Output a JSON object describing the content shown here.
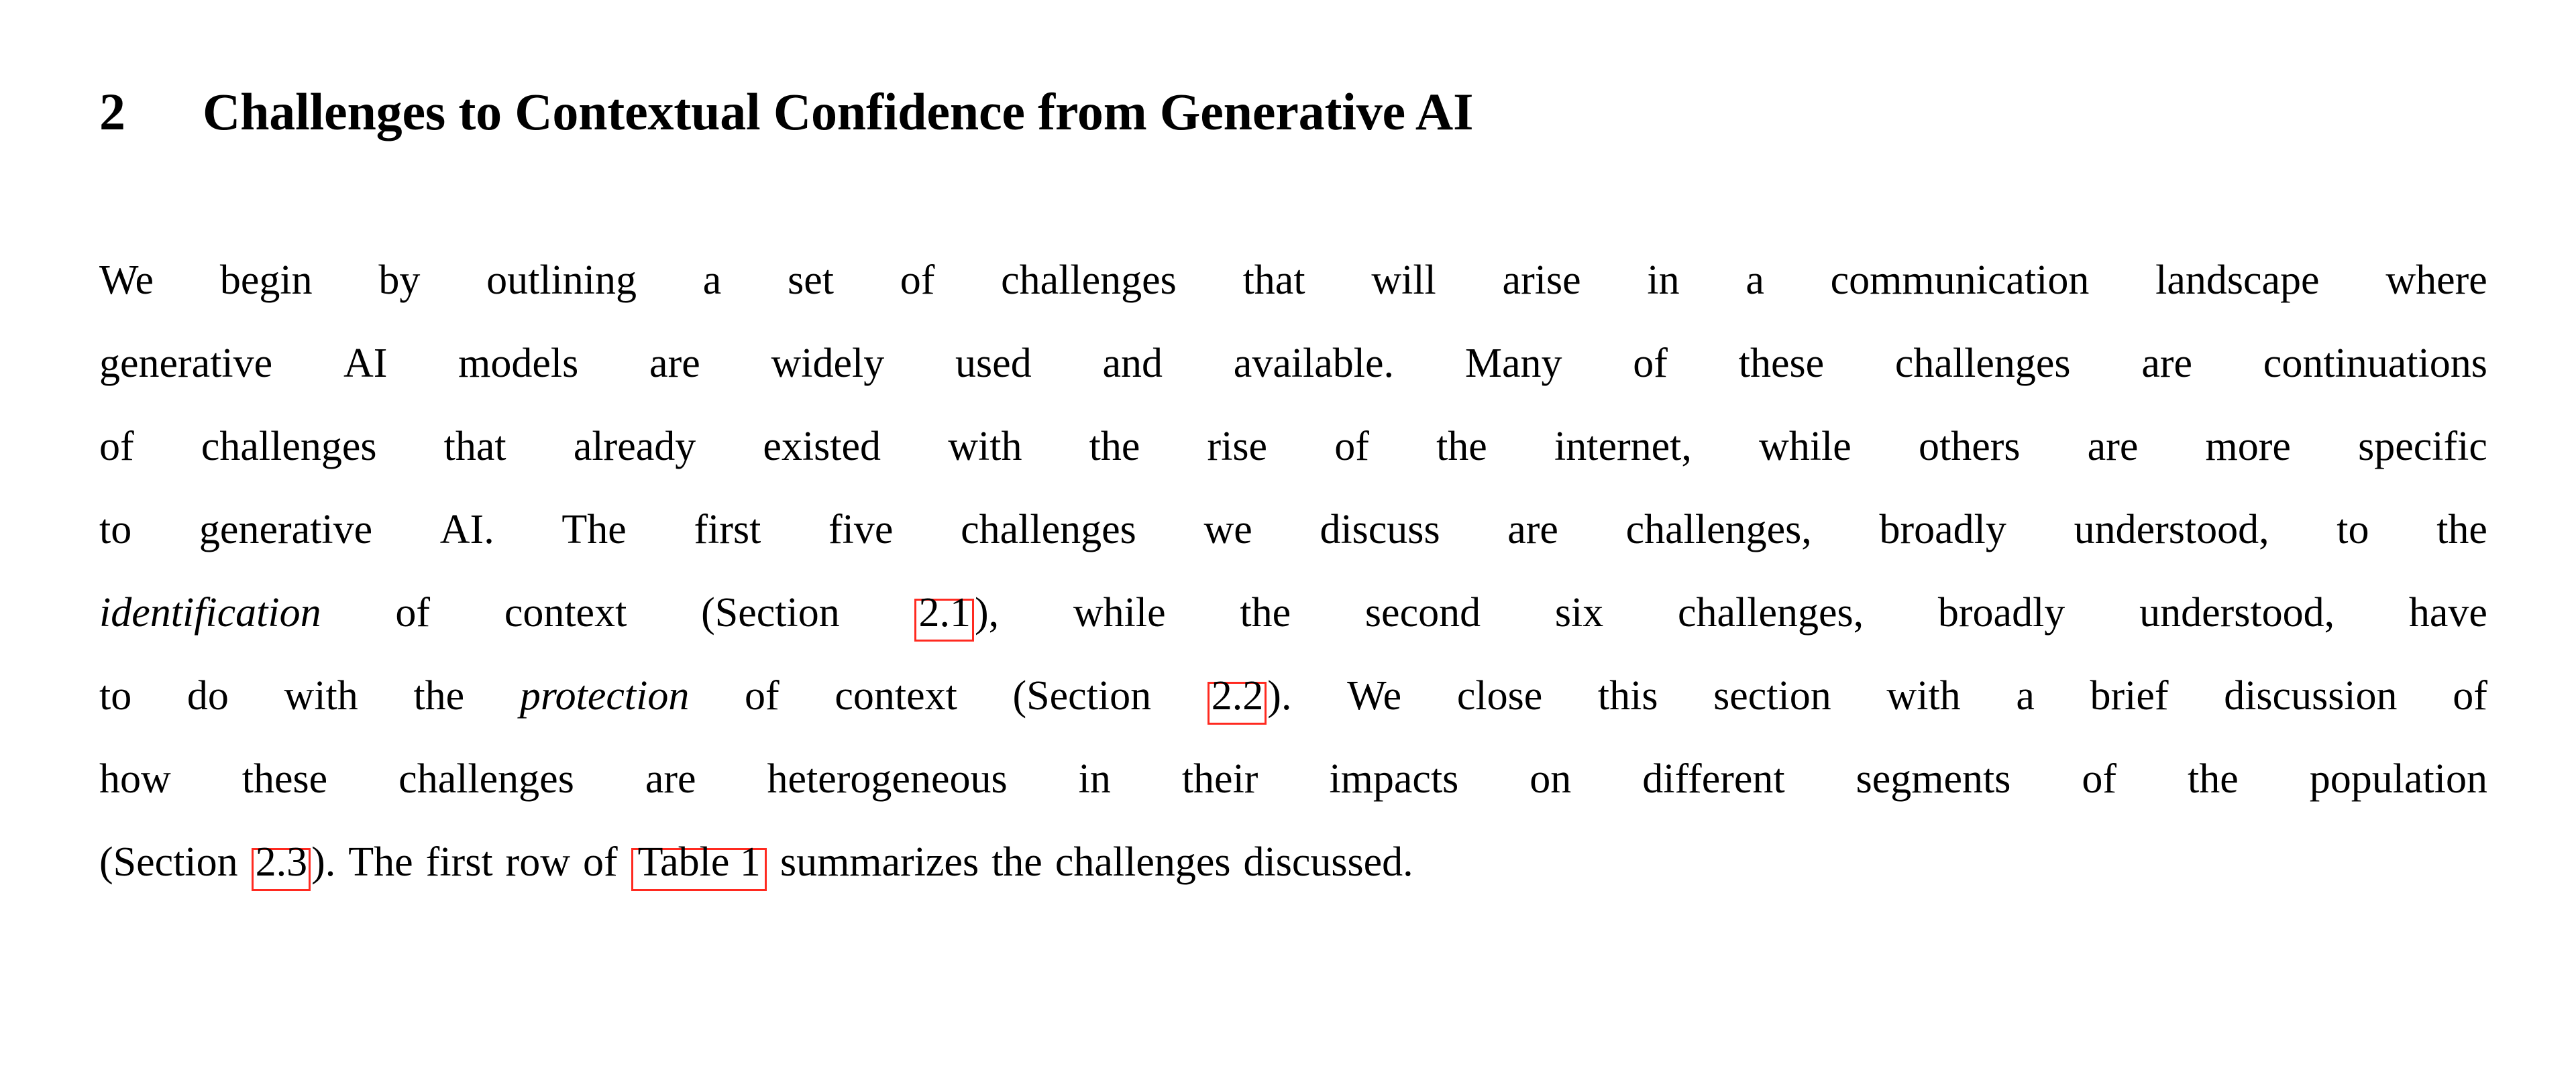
{
  "document": {
    "kind": "academic-paper-section",
    "background_color": "#ffffff",
    "text_color": "#000000",
    "link_box_color": "#ff2a20"
  },
  "heading": {
    "number": "2",
    "title": "Challenges to Contextual Confidence from Generative AI"
  },
  "paragraph": {
    "full_text": "We begin by outlining a set of challenges that will arise in a communication landscape where generative AI models are widely used and available. Many of these challenges are continuations of challenges that already existed with the rise of the internet, while others are more specific to generative AI. The first five challenges we discuss are challenges, broadly understood, to the identification of context (Section 2.1), while the second six challenges, broadly understood, have to do with the protection of context (Section 2.2). We close this section with a brief discussion of how these challenges are heterogeneous in their impacts on different segments of the population (Section 2.3). The first row of Table 1 summarizes the challenges discussed.",
    "lines": [
      {
        "id": "line-1",
        "words": [
          "We",
          "begin",
          "by",
          "outlining",
          "a",
          "set",
          "of",
          "challenges",
          "that",
          "will",
          "arise",
          "in",
          "a",
          "communication",
          "landscape",
          "where"
        ]
      },
      {
        "id": "line-2",
        "words": [
          "generative",
          "AI",
          "models",
          "are",
          "widely",
          "used",
          "and",
          "available.",
          "Many",
          "of",
          "these",
          "challenges",
          "are",
          "continuations"
        ]
      },
      {
        "id": "line-3",
        "words": [
          "of",
          "challenges",
          "that",
          "already",
          "existed",
          "with",
          "the",
          "rise",
          "of",
          "the",
          "internet,",
          "while",
          "others",
          "are",
          "more",
          "specific"
        ]
      },
      {
        "id": "line-4",
        "words": [
          "to",
          "generative",
          "AI.",
          "The",
          "first",
          "five",
          "challenges",
          "we",
          "discuss",
          "are",
          "challenges,",
          "broadly",
          "understood,",
          "to",
          "the"
        ]
      },
      {
        "id": "line-5",
        "segments": [
          {
            "type": "italic",
            "text": "identification"
          },
          {
            "type": "text",
            "text": "of"
          },
          {
            "type": "text",
            "text": "context"
          },
          {
            "type": "text",
            "text": "(Section"
          },
          {
            "type": "link",
            "text": "2.1",
            "trailing": "),"
          },
          {
            "type": "text",
            "text": "while"
          },
          {
            "type": "text",
            "text": "the"
          },
          {
            "type": "text",
            "text": "second"
          },
          {
            "type": "text",
            "text": "six"
          },
          {
            "type": "text",
            "text": "challenges,"
          },
          {
            "type": "text",
            "text": "broadly"
          },
          {
            "type": "text",
            "text": "understood,"
          },
          {
            "type": "text",
            "text": "have"
          }
        ]
      },
      {
        "id": "line-6",
        "segments": [
          {
            "type": "text",
            "text": "to"
          },
          {
            "type": "text",
            "text": "do"
          },
          {
            "type": "text",
            "text": "with"
          },
          {
            "type": "text",
            "text": "the"
          },
          {
            "type": "italic",
            "text": "protection"
          },
          {
            "type": "text",
            "text": "of"
          },
          {
            "type": "text",
            "text": "context"
          },
          {
            "type": "text",
            "text": "(Section"
          },
          {
            "type": "link",
            "text": "2.2",
            "trailing": ")."
          },
          {
            "type": "text",
            "text": "We"
          },
          {
            "type": "text",
            "text": "close"
          },
          {
            "type": "text",
            "text": "this"
          },
          {
            "type": "text",
            "text": "section"
          },
          {
            "type": "text",
            "text": "with"
          },
          {
            "type": "text",
            "text": "a"
          },
          {
            "type": "text",
            "text": "brief"
          },
          {
            "type": "text",
            "text": "discussion"
          },
          {
            "type": "text",
            "text": "of"
          }
        ]
      },
      {
        "id": "line-7",
        "words": [
          "how",
          "these",
          "challenges",
          "are",
          "heterogeneous",
          "in",
          "their",
          "impacts",
          "on",
          "different",
          "segments",
          "of",
          "the",
          "population"
        ]
      },
      {
        "id": "line-8",
        "segments": [
          {
            "type": "text",
            "text": "(Section"
          },
          {
            "type": "link",
            "text": "2.3",
            "trailing": ")."
          },
          {
            "type": "text",
            "text": "The"
          },
          {
            "type": "text",
            "text": "first"
          },
          {
            "type": "text",
            "text": "row"
          },
          {
            "type": "text",
            "text": "of"
          },
          {
            "type": "link",
            "text": "Table 1",
            "wide": true
          },
          {
            "type": "text",
            "text": "summarizes"
          },
          {
            "type": "text",
            "text": "the"
          },
          {
            "type": "text",
            "text": "challenges"
          },
          {
            "type": "text",
            "text": "discussed."
          }
        ]
      }
    ],
    "cross_references": [
      {
        "label": "2.1",
        "kind": "section-link"
      },
      {
        "label": "2.2",
        "kind": "section-link"
      },
      {
        "label": "2.3",
        "kind": "section-link"
      },
      {
        "label": "Table 1",
        "kind": "table-link"
      }
    ]
  }
}
